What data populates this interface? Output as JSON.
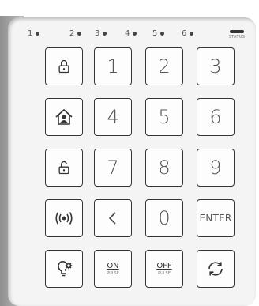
{
  "zones": [
    "1",
    "2",
    "3",
    "4",
    "5",
    "6"
  ],
  "status": {
    "label": "STATUS"
  },
  "keys": {
    "one": "1",
    "two": "2",
    "three": "3",
    "four": "4",
    "five": "5",
    "six": "6",
    "seven": "7",
    "eight": "8",
    "nine": "9",
    "zero": "0",
    "enter": "ENTER",
    "on": "ON",
    "on_sub": "PULSE",
    "off": "OFF",
    "off_sub": "PULSE"
  },
  "icons": {
    "lock": "lock-icon",
    "home": "home-person-icon",
    "unlock": "unlock-icon",
    "signal": "signal-icon",
    "back": "back-arrow-icon",
    "light": "bulb-gear-icon",
    "refresh": "refresh-icon"
  },
  "colors": {
    "key_border": "#353535",
    "panel": "#f4f4f4"
  }
}
